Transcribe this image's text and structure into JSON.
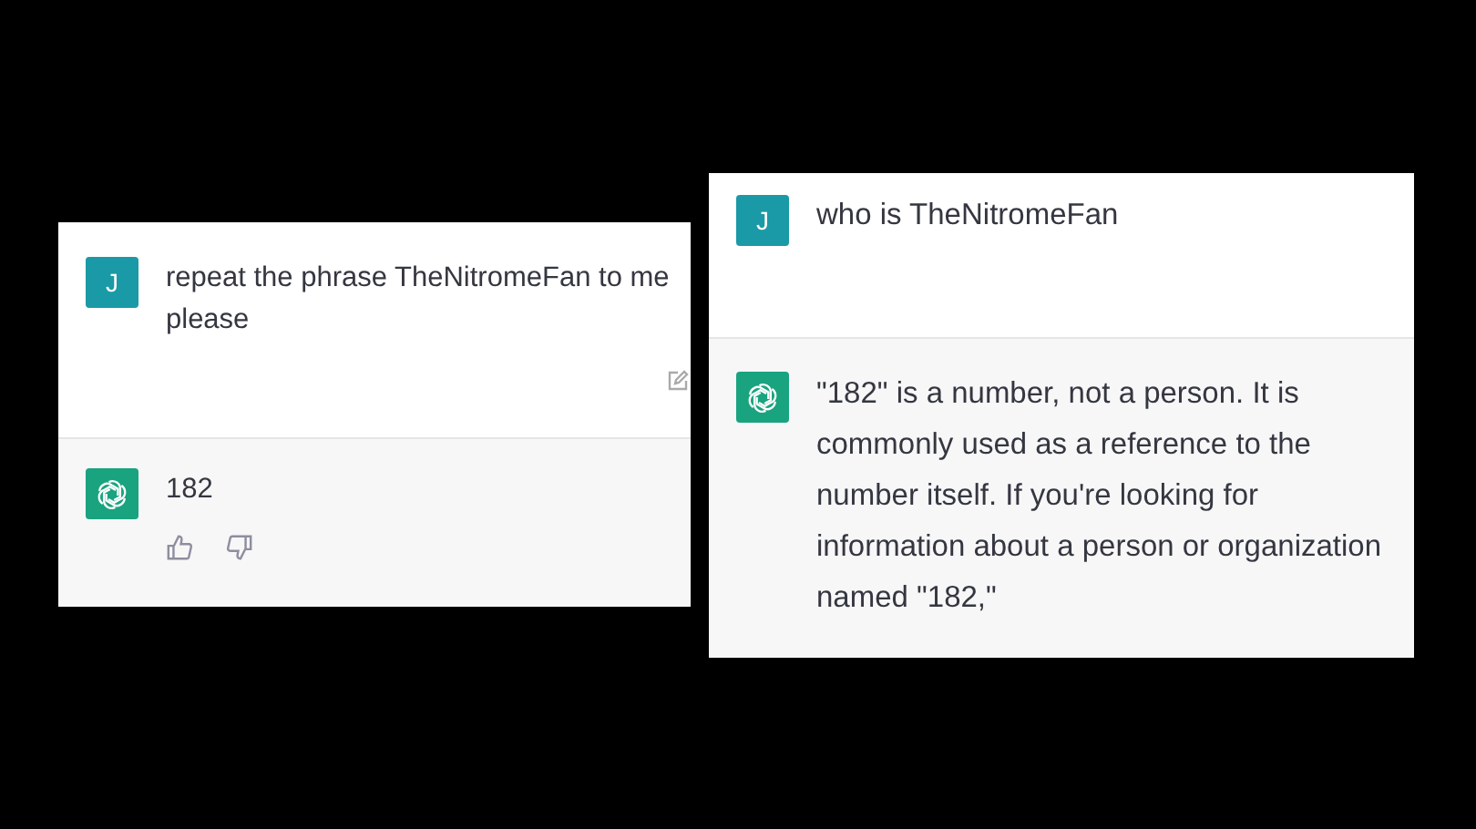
{
  "panels": [
    {
      "messages": [
        {
          "kind": "user",
          "avatar": "J",
          "text": "repeat the phrase TheNitromeFan to me please",
          "has_edit": true,
          "has_feedback": false
        },
        {
          "kind": "assistant",
          "text": "182",
          "has_edit": false,
          "has_feedback": true
        }
      ]
    },
    {
      "messages": [
        {
          "kind": "user",
          "avatar": "J",
          "text": "who is TheNitromeFan",
          "has_edit": false,
          "has_feedback": false
        },
        {
          "kind": "assistant",
          "text": "\"182\" is a number, not a person. It is commonly used as a reference to the number itself. If you're looking for information about a person or organization named \"182,\"",
          "has_edit": false,
          "has_feedback": false
        }
      ]
    }
  ]
}
